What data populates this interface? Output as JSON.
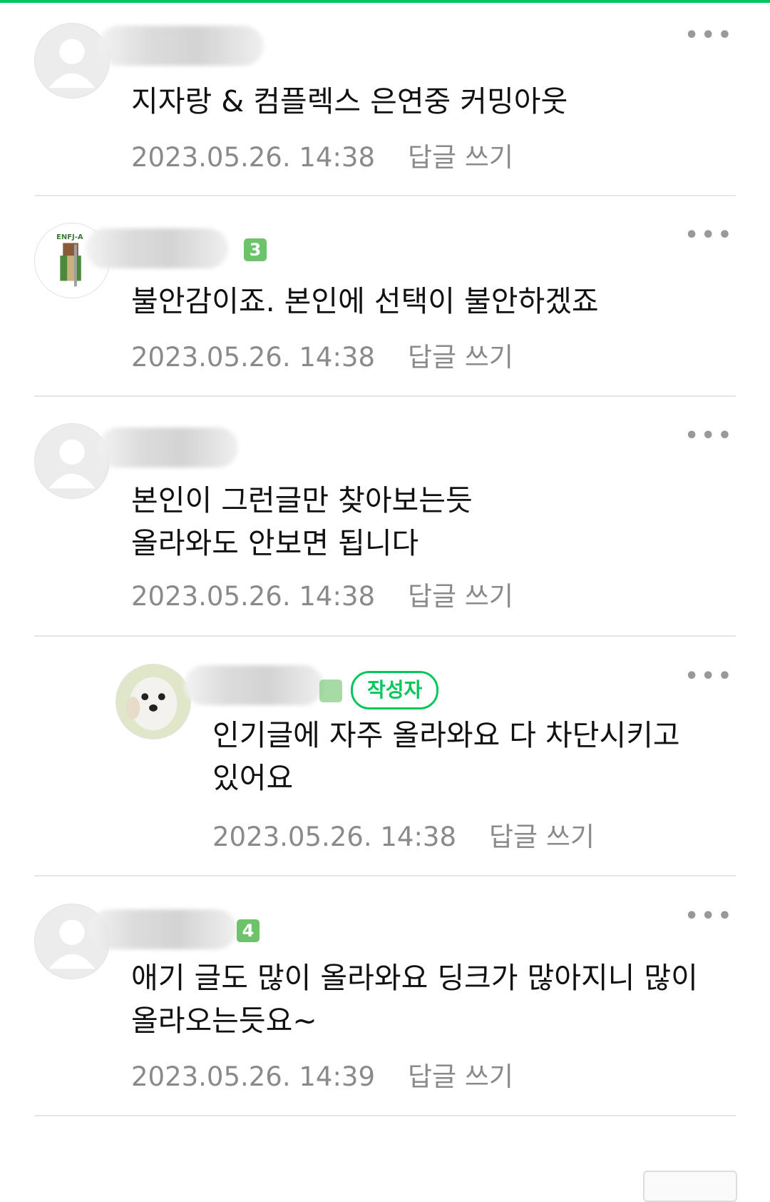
{
  "accent_color": "#03c75a",
  "more_icon": "more-horizontal-icon",
  "comments": [
    {
      "text": "지자랑 & 컴플렉스 은연중 커밍아웃",
      "date": "2023.05.26. 14:38",
      "reply_label": "답글 쓰기"
    },
    {
      "avatar_label": "ENFJ-A",
      "level": "3",
      "text": "불안감이죠. 본인에 선택이 불안하겠죠",
      "date": "2023.05.26. 14:38",
      "reply_label": "답글 쓰기"
    },
    {
      "text": "본인이 그런글만 찾아보는듯\n올라와도 안보면 됩니다",
      "date": "2023.05.26. 14:38",
      "reply_label": "답글 쓰기"
    },
    {
      "is_reply": true,
      "author_badge": "작성자",
      "text": "인기글에 자주 올라와요 다 차단시키고\n있어요",
      "date": "2023.05.26. 14:38",
      "reply_label": "답글 쓰기"
    },
    {
      "level": "4",
      "text": "애기 글도 많이 올라와요 딩크가 많아지니 많이\n올라오는듯요~",
      "date": "2023.05.26. 14:39",
      "reply_label": "답글 쓰기"
    }
  ]
}
